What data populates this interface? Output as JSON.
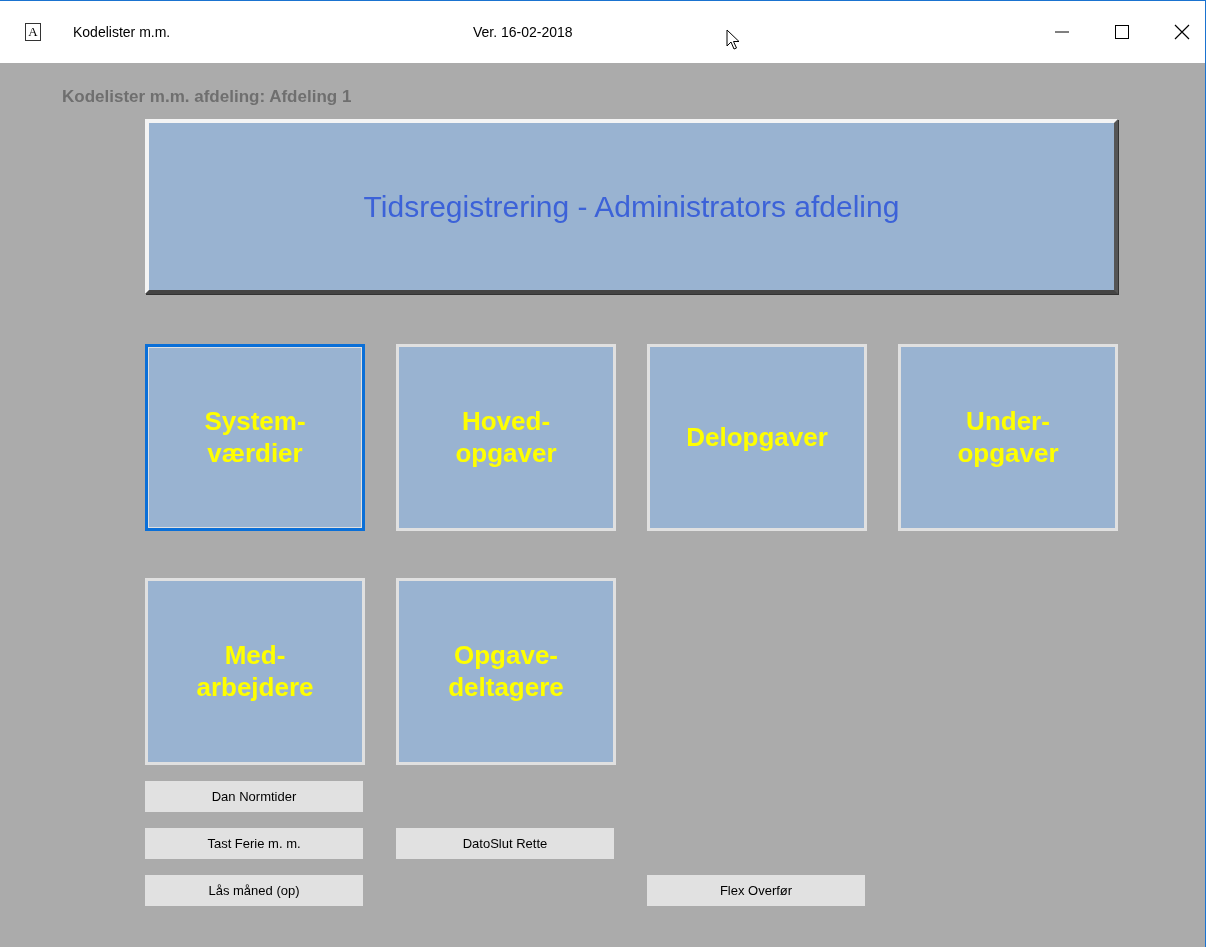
{
  "window": {
    "icon_glyph": "A",
    "title": "Kodelister m.m.",
    "version": "Ver. 16-02-2018"
  },
  "department_label": "Kodelister m.m. afdeling: Afdeling 1",
  "banner": "Tidsregistrering - Administrators afdeling",
  "tile_rows": [
    [
      {
        "label": "System-\nværdier",
        "selected": true
      },
      {
        "label": "Hoved-\nopgaver",
        "selected": false
      },
      {
        "label": "Delopgaver",
        "selected": false
      },
      {
        "label": "Under-\nopgaver",
        "selected": false
      }
    ],
    [
      {
        "label": "Med-\narbejdere",
        "selected": false
      },
      {
        "label": "Opgave-\ndeltagere",
        "selected": false
      }
    ]
  ],
  "small_button_rows": [
    [
      "Dan Normtider"
    ],
    [
      "Tast Ferie m. m.",
      "DatoSlut Rette"
    ],
    [
      "Lås måned (op)",
      null,
      "Flex Overfør"
    ]
  ]
}
